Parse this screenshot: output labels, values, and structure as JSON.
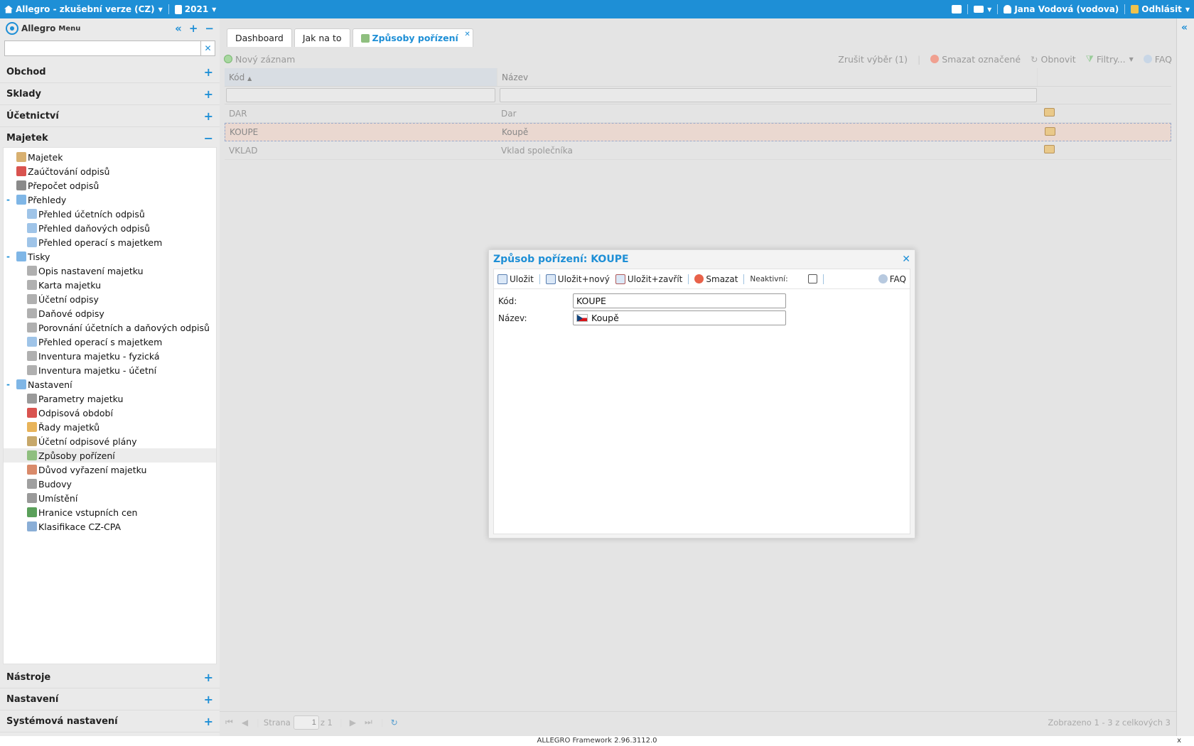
{
  "topbar": {
    "app_title": "Allegro - zkušební verze (CZ)",
    "year": "2021",
    "user": "Jana Vodová (vodova)",
    "logout": "Odhlásit"
  },
  "sidebar": {
    "brand": "Allegro",
    "menu_label": "Menu",
    "search_value": "",
    "sections_top": [
      "Obchod",
      "Sklady",
      "Účetnictví"
    ],
    "active_section": "Majetek",
    "tree": [
      {
        "label": "Majetek",
        "level": 0,
        "icon": "asset-icon"
      },
      {
        "label": "Zaúčtování odpisů",
        "level": 0,
        "icon": "calendar-icon"
      },
      {
        "label": "Přepočet odpisů",
        "level": 0,
        "icon": "calculator-icon"
      },
      {
        "label": "Přehledy",
        "level": 0,
        "icon": "folder-icon",
        "toggle": "-"
      },
      {
        "label": "Přehled účetních odpisů",
        "level": 1,
        "icon": "report-icon"
      },
      {
        "label": "Přehled daňových odpisů",
        "level": 1,
        "icon": "report-icon"
      },
      {
        "label": "Přehled operací s majetkem",
        "level": 1,
        "icon": "report-icon"
      },
      {
        "label": "Tisky",
        "level": 0,
        "icon": "folder-icon",
        "toggle": "-"
      },
      {
        "label": "Opis nastavení majetku",
        "level": 1,
        "icon": "printer-icon"
      },
      {
        "label": "Karta majetku",
        "level": 1,
        "icon": "printer-icon"
      },
      {
        "label": "Účetní odpisy",
        "level": 1,
        "icon": "printer-icon"
      },
      {
        "label": "Daňové odpisy",
        "level": 1,
        "icon": "printer-icon"
      },
      {
        "label": "Porovnání účetních a daňových odpisů",
        "level": 1,
        "icon": "printer-icon"
      },
      {
        "label": "Přehled operací s majetkem",
        "level": 1,
        "icon": "report-icon"
      },
      {
        "label": "Inventura majetku - fyzická",
        "level": 1,
        "icon": "printer-icon"
      },
      {
        "label": "Inventura majetku - účetní",
        "level": 1,
        "icon": "printer-icon"
      },
      {
        "label": "Nastavení",
        "level": 0,
        "icon": "folder-icon",
        "toggle": "-"
      },
      {
        "label": "Parametry majetku",
        "level": 1,
        "icon": "gear-icon"
      },
      {
        "label": "Odpisová období",
        "level": 1,
        "icon": "calendar-icon"
      },
      {
        "label": "Řady majetků",
        "level": 1,
        "icon": "series-icon"
      },
      {
        "label": "Účetní odpisové plány",
        "level": 1,
        "icon": "plan-icon"
      },
      {
        "label": "Způsoby pořízení",
        "level": 1,
        "icon": "acquisition-icon",
        "selected": true
      },
      {
        "label": "Důvod vyřazení majetku",
        "level": 1,
        "icon": "disposal-icon"
      },
      {
        "label": "Budovy",
        "level": 1,
        "icon": "building-icon"
      },
      {
        "label": "Umístění",
        "level": 1,
        "icon": "location-icon"
      },
      {
        "label": "Hranice vstupních cen",
        "level": 1,
        "icon": "dollar-icon"
      },
      {
        "label": "Klasifikace CZ-CPA",
        "level": 1,
        "icon": "list-icon"
      }
    ],
    "sections_bottom": [
      "Nástroje",
      "Nastavení",
      "Systémová nastavení"
    ]
  },
  "tabs": [
    {
      "label": "Dashboard"
    },
    {
      "label": "Jak na to"
    },
    {
      "label": "Způsoby pořízení",
      "active": true
    }
  ],
  "toolbar": {
    "new_record": "Nový záznam",
    "clear_selection": "Zrušit výběr (1)",
    "delete_marked": "Smazat označené",
    "refresh": "Obnovit",
    "filters": "Filtry...",
    "faq": "FAQ"
  },
  "grid": {
    "col_code": "Kód",
    "col_name": "Název",
    "rows": [
      {
        "code": "DAR",
        "name": "Dar"
      },
      {
        "code": "KOUPE",
        "name": "Koupě",
        "selected": true
      },
      {
        "code": "VKLAD",
        "name": "Vklad společníka"
      }
    ]
  },
  "pager": {
    "page_label": "Strana",
    "page_value": "1",
    "of_label": "z 1",
    "total": "Zobrazeno 1 - 3 z celkových 3"
  },
  "dialog": {
    "title": "Způsob pořízení: KOUPE",
    "save": "Uložit",
    "save_new": "Uložit+nový",
    "save_close": "Uložit+zavřít",
    "delete": "Smazat",
    "inactive_label": "Neaktivní:",
    "faq": "FAQ",
    "code_label": "Kód:",
    "code_value": "KOUPE",
    "name_label": "Název:",
    "name_value": "Koupě"
  },
  "footer": {
    "text": "ALLEGRO Framework 2.96.3112.0",
    "close": "x"
  },
  "colors": {
    "accent": "#1e8fd6",
    "selected_row": "#ead8d0"
  }
}
